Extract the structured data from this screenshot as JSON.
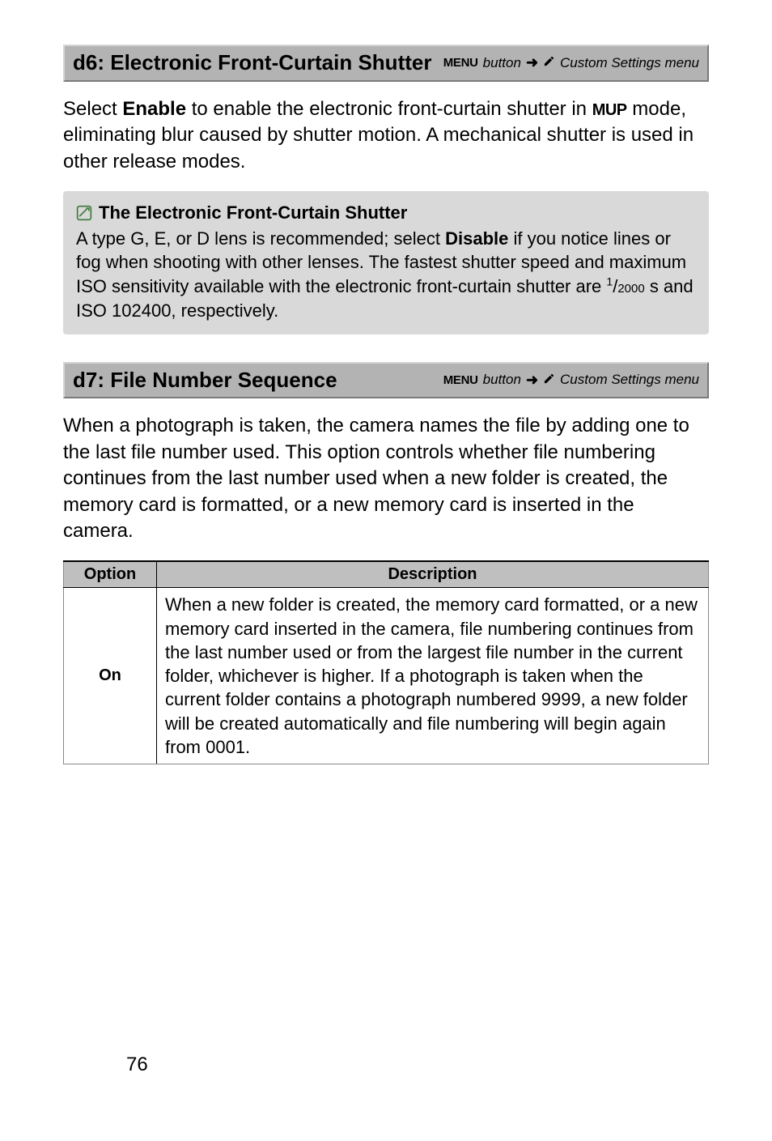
{
  "section1": {
    "title": "d6: Electronic Front-Curtain Shutter",
    "breadcrumb": {
      "menu_label": "MENU",
      "button_text": "button",
      "menu_name": "Custom Settings menu"
    },
    "body_prefix": "Select ",
    "body_enable": "Enable",
    "body_mid": " to enable the electronic front-curtain shutter in ",
    "body_mup": "MUP",
    "body_suffix": " mode, eliminating blur caused by shutter motion.  A mechanical shutter is used in other release modes."
  },
  "note": {
    "title": "The Electronic Front-Curtain Shutter",
    "text_prefix": "A type G, E, or D lens is recommended; select ",
    "text_disable": "Disable",
    "text_mid": " if you notice lines or fog when shooting with other lenses.  The fastest shutter speed and maximum ISO sensitivity available with the electronic front-curtain shutter are ",
    "fraction_num": "1",
    "fraction_den": "2000",
    "text_suffix": " s and ISO 102400, respectively."
  },
  "section2": {
    "title": "d7: File Number Sequence",
    "breadcrumb": {
      "menu_label": "MENU",
      "button_text": "button",
      "menu_name": "Custom Settings menu"
    },
    "body": "When a photograph is taken, the camera names the file by adding one to the last file number used.  This option controls whether file numbering continues from the last number used when a new folder is created, the memory card is formatted, or a new memory card is inserted in the camera."
  },
  "table": {
    "headers": {
      "option": "Option",
      "description": "Description"
    },
    "rows": [
      {
        "option": "On",
        "description": "When a new folder is created, the memory card formatted, or a new memory card inserted in the camera, file numbering continues from the last number used or from the largest file number in the current folder, whichever is higher.  If a photograph is taken when the current folder contains a photograph numbered 9999, a new folder will be created automatically and file numbering will begin again from 0001."
      }
    ]
  },
  "page_number": "76"
}
